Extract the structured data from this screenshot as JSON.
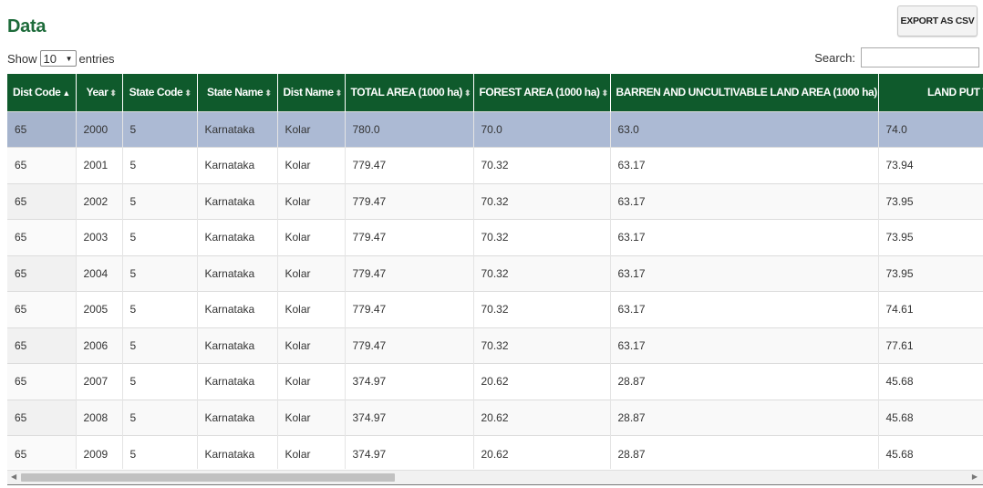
{
  "page": {
    "title": "Data"
  },
  "toolbar": {
    "export_label": "EXPORT AS CSV"
  },
  "length": {
    "show_label": "Show",
    "value": "10",
    "entries_label": "entries"
  },
  "search": {
    "label": "Search:",
    "placeholder": ""
  },
  "table": {
    "columns": [
      {
        "label": "Dist Code",
        "sort": "asc"
      },
      {
        "label": "Year",
        "sort": "both"
      },
      {
        "label": "State Code",
        "sort": "both"
      },
      {
        "label": "State Name",
        "sort": "both"
      },
      {
        "label": "Dist Name",
        "sort": "both"
      },
      {
        "label": "TOTAL AREA (1000 ha)",
        "sort": "both"
      },
      {
        "label": "FOREST AREA (1000 ha)",
        "sort": "both"
      },
      {
        "label": "BARREN AND UNCULTIVABLE LAND AREA (1000 ha)",
        "sort": "both"
      },
      {
        "label": "LAND PUT TO NON",
        "sort": "none"
      }
    ],
    "rows": [
      [
        "65",
        "2000",
        "5",
        "Karnataka",
        "Kolar",
        "780.0",
        "70.0",
        "63.0",
        "74.0"
      ],
      [
        "65",
        "2001",
        "5",
        "Karnataka",
        "Kolar",
        "779.47",
        "70.32",
        "63.17",
        "73.94"
      ],
      [
        "65",
        "2002",
        "5",
        "Karnataka",
        "Kolar",
        "779.47",
        "70.32",
        "63.17",
        "73.95"
      ],
      [
        "65",
        "2003",
        "5",
        "Karnataka",
        "Kolar",
        "779.47",
        "70.32",
        "63.17",
        "73.95"
      ],
      [
        "65",
        "2004",
        "5",
        "Karnataka",
        "Kolar",
        "779.47",
        "70.32",
        "63.17",
        "73.95"
      ],
      [
        "65",
        "2005",
        "5",
        "Karnataka",
        "Kolar",
        "779.47",
        "70.32",
        "63.17",
        "74.61"
      ],
      [
        "65",
        "2006",
        "5",
        "Karnataka",
        "Kolar",
        "779.47",
        "70.32",
        "63.17",
        "77.61"
      ],
      [
        "65",
        "2007",
        "5",
        "Karnataka",
        "Kolar",
        "374.97",
        "20.62",
        "28.87",
        "45.68"
      ],
      [
        "65",
        "2008",
        "5",
        "Karnataka",
        "Kolar",
        "374.97",
        "20.62",
        "28.87",
        "45.68"
      ],
      [
        "65",
        "2009",
        "5",
        "Karnataka",
        "Kolar",
        "374.97",
        "20.62",
        "28.87",
        "45.68"
      ]
    ],
    "selected_row": 0
  },
  "icons": {
    "sort_asc": "▲",
    "sort_both": "▲▼",
    "chevron_down": "⌄",
    "scroll_left": "◀",
    "scroll_right": "▶"
  },
  "colors": {
    "header_bg": "#0f5a2c",
    "title": "#1d6b3a",
    "selected_row": "#acbad4"
  }
}
